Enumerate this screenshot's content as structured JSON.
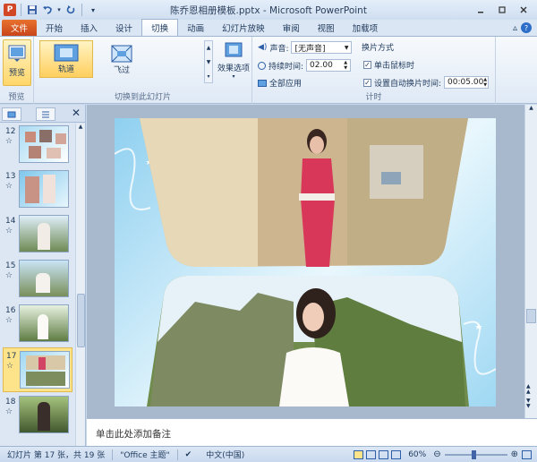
{
  "window": {
    "title": "陈乔恩相册模板.pptx - Microsoft PowerPoint"
  },
  "tabs": [
    {
      "label": "文件"
    },
    {
      "label": "开始"
    },
    {
      "label": "插入"
    },
    {
      "label": "设计"
    },
    {
      "label": "切换"
    },
    {
      "label": "动画"
    },
    {
      "label": "幻灯片放映"
    },
    {
      "label": "审阅"
    },
    {
      "label": "视图"
    },
    {
      "label": "加载项"
    }
  ],
  "ribbon": {
    "preview": {
      "button": "预览",
      "group": "预览"
    },
    "gallery": {
      "items": [
        {
          "label": "轨道"
        },
        {
          "label": "飞过"
        }
      ],
      "effect_options": "效果选项",
      "group": "切换到此幻灯片"
    },
    "timing": {
      "sound_label": "声音:",
      "sound_value": "[无声音]",
      "duration_label": "持续时间:",
      "duration_value": "02.00",
      "apply_all": "全部应用",
      "advance_heading": "换片方式",
      "on_click": "单击鼠标时",
      "auto_after": "设置自动换片时间:",
      "auto_value": "00:05.00",
      "group": "计时"
    }
  },
  "slides": [
    {
      "number": "12"
    },
    {
      "number": "13"
    },
    {
      "number": "14"
    },
    {
      "number": "15"
    },
    {
      "number": "16"
    },
    {
      "number": "17",
      "selected": true
    },
    {
      "number": "18"
    }
  ],
  "notes_placeholder": "单击此处添加备注",
  "statusbar": {
    "slide_info": "幻灯片 第 17 张，共 19 张",
    "theme": "\"Office 主题\"",
    "language": "中文(中国)",
    "zoom": "60%"
  }
}
